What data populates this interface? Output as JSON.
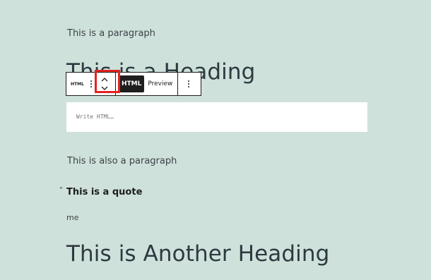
{
  "content": {
    "paragraph_1": "This is a paragraph",
    "heading_1": "This is a Heading",
    "paragraph_2": "This is also a paragraph",
    "quote_mark": "“",
    "quote_text": "This is a quote",
    "quote_citation": "me",
    "heading_2": "This is Another Heading"
  },
  "toolbar": {
    "block_type_label": "HTML",
    "drag_icon": "drag-handle-icon",
    "move_up_icon": "chevron-up-icon",
    "move_down_icon": "chevron-down-icon",
    "html_tab_label": "HTML",
    "preview_tab_label": "Preview",
    "more_icon": "more-vertical-icon"
  },
  "html_editor": {
    "value": "",
    "placeholder": "Write HTML…"
  },
  "colors": {
    "background": "#cfe1db",
    "highlight": "#e3231f",
    "toolbar_border": "#1e1e1e",
    "active_tab": "#1e1e1e"
  }
}
